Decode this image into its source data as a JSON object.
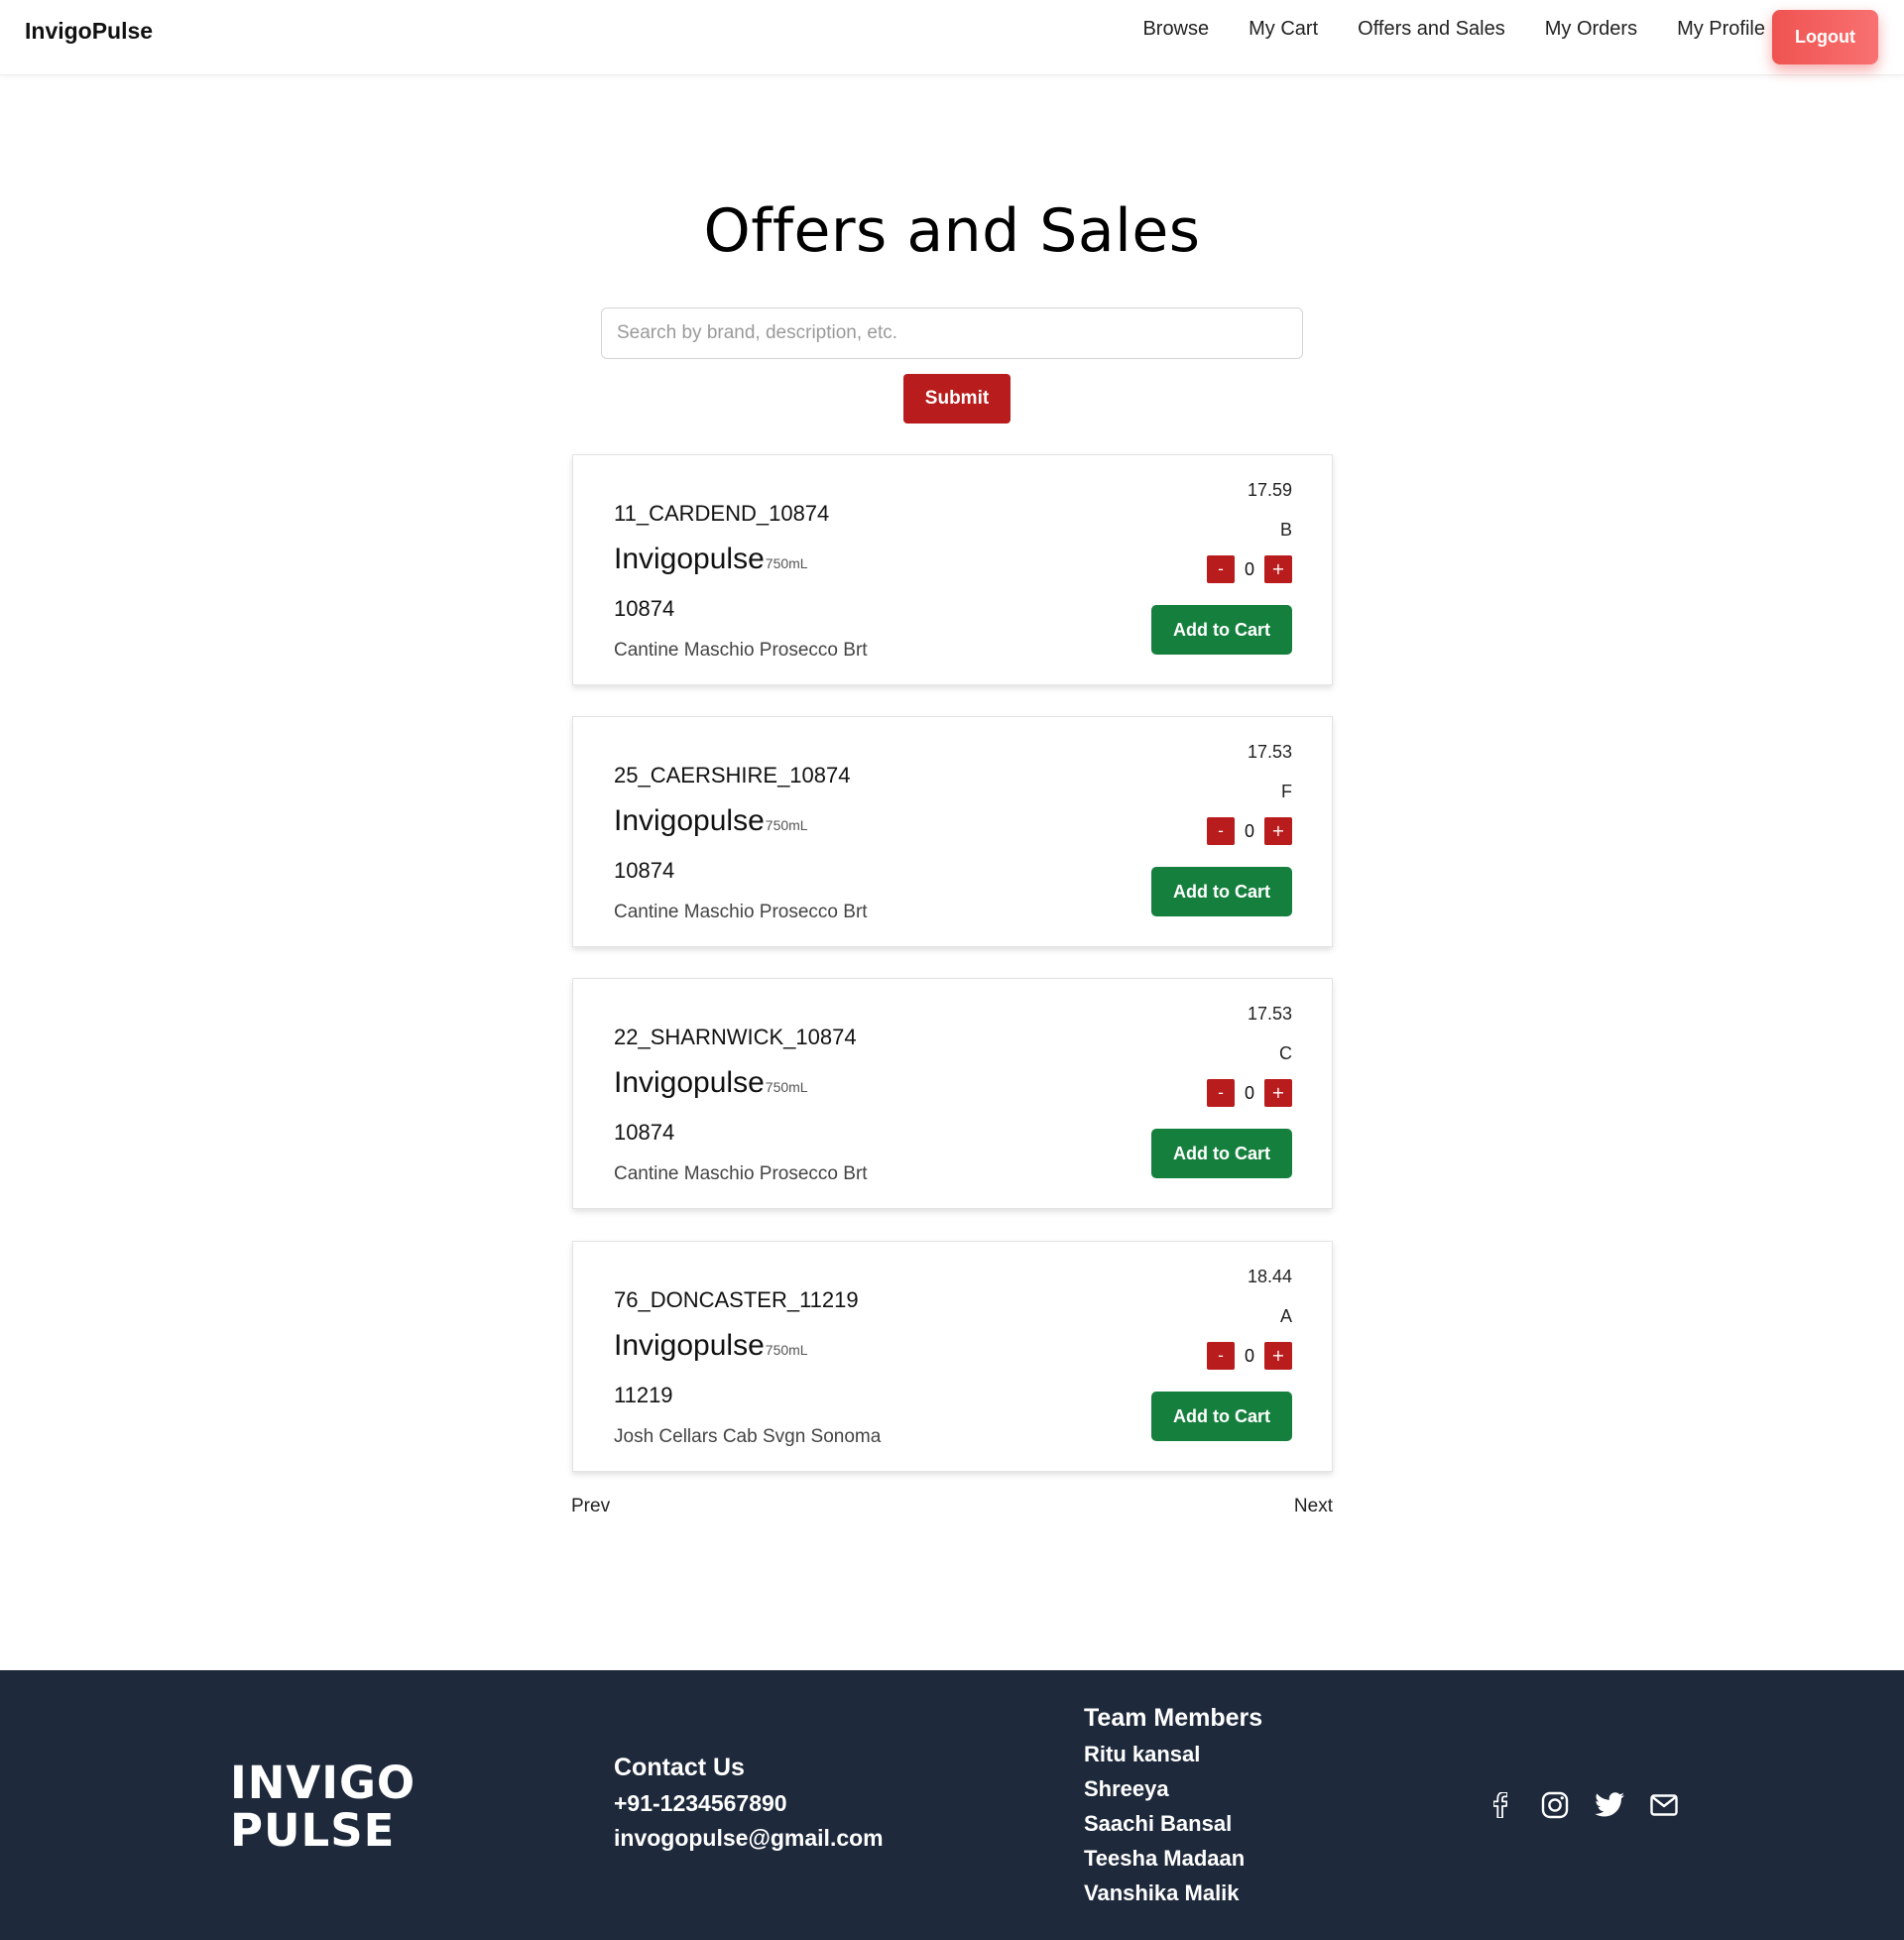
{
  "navbar": {
    "brand": "InvigoPulse",
    "links": [
      "Browse",
      "My Cart",
      "Offers and Sales",
      "My Orders",
      "My Profile"
    ],
    "logout_label": "Logout"
  },
  "main": {
    "title": "Offers and Sales",
    "search": {
      "placeholder": "Search by brand, description, etc.",
      "value": ""
    },
    "submit_label": "Submit",
    "products": [
      {
        "code": "11_CARDEND_10874",
        "brand": "Invigopulse",
        "size": "750mL",
        "number": "10874",
        "description": "Cantine Maschio Prosecco Brt",
        "price": "17.59",
        "grade": "B",
        "quantity": "0",
        "minus_label": "-",
        "plus_label": "+",
        "add_label": "Add to Cart"
      },
      {
        "code": "25_CAERSHIRE_10874",
        "brand": "Invigopulse",
        "size": "750mL",
        "number": "10874",
        "description": "Cantine Maschio Prosecco Brt",
        "price": "17.53",
        "grade": "F",
        "quantity": "0",
        "minus_label": "-",
        "plus_label": "+",
        "add_label": "Add to Cart"
      },
      {
        "code": "22_SHARNWICK_10874",
        "brand": "Invigopulse",
        "size": "750mL",
        "number": "10874",
        "description": "Cantine Maschio Prosecco Brt",
        "price": "17.53",
        "grade": "C",
        "quantity": "0",
        "minus_label": "-",
        "plus_label": "+",
        "add_label": "Add to Cart"
      },
      {
        "code": "76_DONCASTER_11219",
        "brand": "Invigopulse",
        "size": "750mL",
        "number": "11219",
        "description": "Josh Cellars Cab Svgn Sonoma",
        "price": "18.44",
        "grade": "A",
        "quantity": "0",
        "minus_label": "-",
        "plus_label": "+",
        "add_label": "Add to Cart"
      }
    ],
    "pagination": {
      "prev_label": "Prev",
      "next_label": "Next"
    }
  },
  "footer": {
    "logo_line1": "INVIGO",
    "logo_line2": "PULSE",
    "contact": {
      "heading": "Contact Us",
      "phone": "+91-1234567890",
      "email": "invogopulse@gmail.com"
    },
    "team": {
      "heading": "Team Members",
      "members": [
        "Ritu kansal",
        "Shreeya",
        "Saachi Bansal",
        "Teesha Madaan",
        "Vanshika Malik"
      ]
    },
    "social_icons": [
      "facebook-icon",
      "instagram-icon",
      "twitter-icon",
      "mail-icon"
    ]
  },
  "colors": {
    "accent_red": "#b91c1c",
    "logout_red": "#ef5350",
    "add_green": "#15803d",
    "footer_bg": "#1e293b"
  }
}
